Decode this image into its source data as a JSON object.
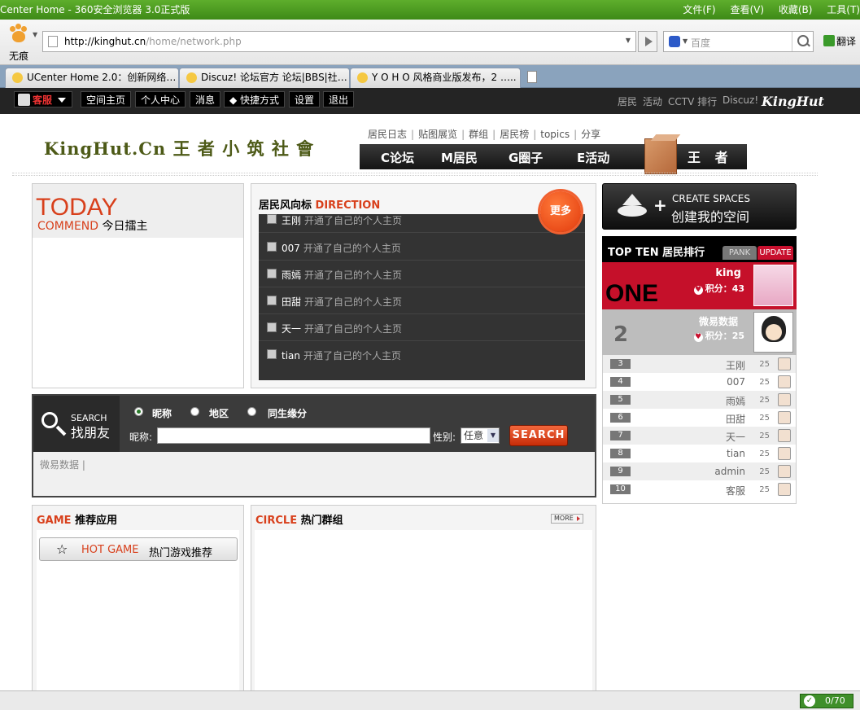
{
  "browser": {
    "title": "Center Home - 360安全浏览器 3.0正式版",
    "menus": [
      "文件(F)",
      "查看(V)",
      "收藏(B)",
      "工具(T)"
    ],
    "paw_label": "无痕",
    "address_domain": "http://kinghut.cn",
    "address_path": "/home/network.php",
    "search_placeholder": "百度",
    "translate": "翻译",
    "tabs": [
      "UCenter Home 2.0：创新网络…",
      "Discuz! 论坛官方 论坛|BBS|社…",
      "Y O H O 风格商业版发布，2 ….."
    ],
    "status_count": "0/70"
  },
  "sitebar": {
    "user": "客服",
    "items": [
      "空间主页",
      "个人中心",
      "消息",
      "快捷方式",
      "设置",
      "退出"
    ],
    "right_links": [
      "居民",
      "活动",
      "CCTV 排行",
      "Discuz!"
    ],
    "logo": "KingHut"
  },
  "header": {
    "logo": "KingHut.Cn 王 者 小 筑 社 會",
    "sublinks": [
      "居民日志",
      "贴图展览",
      "群组",
      "居民榜",
      "topics",
      "分享"
    ],
    "nav": [
      "C论坛",
      "M居民",
      "G圈子",
      "E活动"
    ],
    "nav_name": "王 者"
  },
  "today": {
    "word": "TODAY",
    "commend_en": "COMMEND",
    "commend_cn": "今日擂主"
  },
  "direction": {
    "title_cn": "居民风向标",
    "title_en": "DIRECTION",
    "more": "更多",
    "items": [
      {
        "name": "王刚",
        "action": "开通了自己的个人主页"
      },
      {
        "name": "007",
        "action": "开通了自己的个人主页"
      },
      {
        "name": "雨嫣",
        "action": "开通了自己的个人主页"
      },
      {
        "name": "田甜",
        "action": "开通了自己的个人主页"
      },
      {
        "name": "天一",
        "action": "开通了自己的个人主页"
      },
      {
        "name": "tian",
        "action": "开通了自己的个人主页"
      }
    ]
  },
  "create": {
    "en": "CREATE SPACES",
    "cn": "创建我的空间"
  },
  "rank": {
    "title": "TOP TEN 居民排行",
    "tab1": "PANK",
    "tab2": "UPDATE",
    "score_label": "积分：",
    "first": {
      "big": "ONE",
      "name": "king",
      "score": "43"
    },
    "second": {
      "big": "2",
      "name": "微易数据",
      "score": "25"
    },
    "rows": [
      {
        "num": "3",
        "name": "王刚",
        "score": "25"
      },
      {
        "num": "4",
        "name": "007",
        "score": "25"
      },
      {
        "num": "5",
        "name": "雨嫣",
        "score": "25"
      },
      {
        "num": "6",
        "name": "田甜",
        "score": "25"
      },
      {
        "num": "7",
        "name": "天一",
        "score": "25"
      },
      {
        "num": "8",
        "name": "tian",
        "score": "25"
      },
      {
        "num": "9",
        "name": "admin",
        "score": "25"
      },
      {
        "num": "10",
        "name": "客服",
        "score": "25"
      }
    ]
  },
  "search": {
    "en": "SEARCH",
    "cn": "找朋友",
    "options": [
      "昵称",
      "地区",
      "同生缘分"
    ],
    "nick_label": "昵称:",
    "gender_label": "性别:",
    "gender_value": "任意",
    "button": "SEARCH",
    "recent": "微易数据 |"
  },
  "game": {
    "title_en": "GAME",
    "title_cn": "推荐应用",
    "hot_en": "HOT GAME",
    "hot_cn": "热门游戏推荐"
  },
  "circle": {
    "title_en": "CIRCLE",
    "title_cn": "热门群组",
    "more": "MORE"
  }
}
